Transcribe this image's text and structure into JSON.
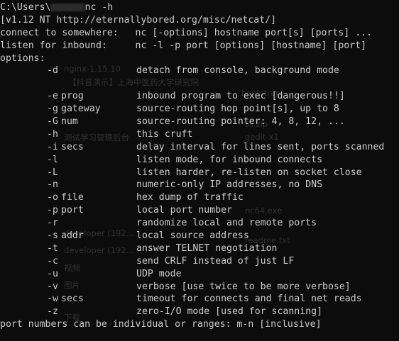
{
  "prompt": {
    "prefix": "C:\\Users\\",
    "suffix": "nc -h"
  },
  "header_lines": [
    "[v1.12 NT http://eternallybored.org/misc/netcat/]",
    "connect to somewhere:   nc [-options] hostname port[s] [ports] ...",
    "listen for inbound:     nc -l -p port [options] [hostname] [port]",
    "options:"
  ],
  "options": [
    {
      "flag": "-d",
      "arg": "",
      "desc": "detach from console, background mode"
    },
    {
      "flag": "",
      "arg": "",
      "desc": ""
    },
    {
      "flag": "-e",
      "arg": "prog",
      "desc": "inbound program to exec [dangerous!!]"
    },
    {
      "flag": "-g",
      "arg": "gateway",
      "desc": "source-routing hop point[s], up to 8"
    },
    {
      "flag": "-G",
      "arg": "num",
      "desc": "source-routing pointer: 4, 8, 12, ..."
    },
    {
      "flag": "-h",
      "arg": "",
      "desc": "this cruft"
    },
    {
      "flag": "-i",
      "arg": "secs",
      "desc": "delay interval for lines sent, ports scanned"
    },
    {
      "flag": "-l",
      "arg": "",
      "desc": "listen mode, for inbound connects"
    },
    {
      "flag": "-L",
      "arg": "",
      "desc": "listen harder, re-listen on socket close"
    },
    {
      "flag": "-n",
      "arg": "",
      "desc": "numeric-only IP addresses, no DNS"
    },
    {
      "flag": "-o",
      "arg": "file",
      "desc": "hex dump of traffic"
    },
    {
      "flag": "-p",
      "arg": "port",
      "desc": "local port number"
    },
    {
      "flag": "-r",
      "arg": "",
      "desc": "randomize local and remote ports"
    },
    {
      "flag": "-s",
      "arg": "addr",
      "desc": "local source address"
    },
    {
      "flag": "-t",
      "arg": "",
      "desc": "answer TELNET negotiation"
    },
    {
      "flag": "-c",
      "arg": "",
      "desc": "send CRLF instead of just LF"
    },
    {
      "flag": "-u",
      "arg": "",
      "desc": "UDP mode"
    },
    {
      "flag": "-v",
      "arg": "",
      "desc": "verbose [use twice to be more verbose]"
    },
    {
      "flag": "-w",
      "arg": "secs",
      "desc": "timeout for connects and final net reads"
    },
    {
      "flag": "-z",
      "arg": "",
      "desc": "zero-I/O mode [used for scanning]"
    }
  ],
  "footer_line": "port numbers can be individual or ranges: m-n [inclusive]",
  "ghost_text": [
    "nginx-1.15.10",
    "【抖音演示】上海中医药大学研究院",
    "bootstrap",
    "测试学习管理后台",
    "ss.zip",
    "gedit-x1",
    "nc64.exe",
    "developer (192...",
    "readme.txt",
    "developer (192...",
    "视频",
    "图片",
    "下载"
  ],
  "colors": {
    "background": "#0c0c0c",
    "foreground": "#cccccc"
  }
}
